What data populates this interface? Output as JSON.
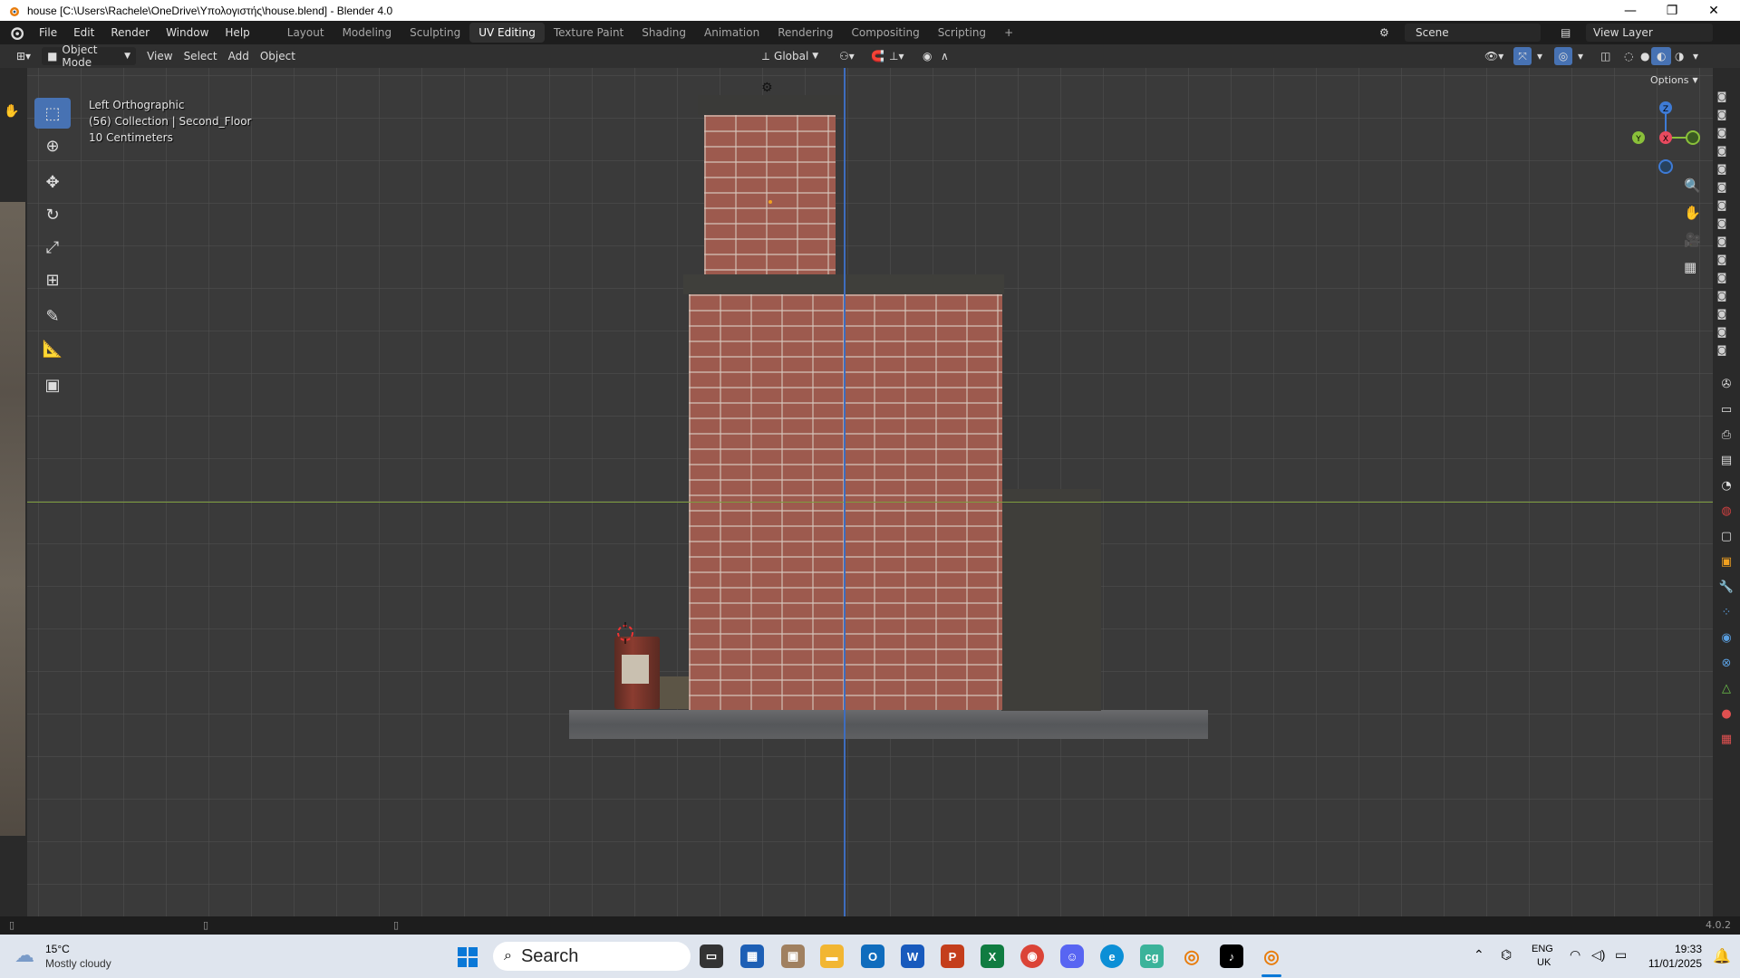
{
  "window": {
    "title": "house [C:\\Users\\Rachele\\OneDrive\\Υπολογιστής\\house.blend] - Blender 4.0",
    "minimize": "—",
    "maximize": "❐",
    "close": "✕"
  },
  "menu": [
    "File",
    "Edit",
    "Render",
    "Window",
    "Help"
  ],
  "workspaces": [
    "Layout",
    "Modeling",
    "Sculpting",
    "UV Editing",
    "Texture Paint",
    "Shading",
    "Animation",
    "Rendering",
    "Compositing",
    "Scripting"
  ],
  "active_workspace": "UV Editing",
  "add_workspace": "+",
  "scene": {
    "label": "Scene",
    "view_layer": "View Layer"
  },
  "header": {
    "mode": "Object Mode",
    "view": "View",
    "select": "Select",
    "add": "Add",
    "object": "Object",
    "orientation": "Global",
    "options": "Options"
  },
  "viewport": {
    "view_name": "Left Orthographic",
    "collection": "(56) Collection | Second_Floor",
    "scale": "10 Centimeters"
  },
  "gizmo": {
    "z": "Z",
    "y": "Y",
    "x": "X"
  },
  "statusbar": {
    "version": "4.0.2"
  },
  "taskbar": {
    "weather_temp": "15°C",
    "weather_desc": "Mostly cloudy",
    "search": "Search",
    "lang": "ENG",
    "region": "UK",
    "time": "19:33",
    "date": "11/01/2025"
  },
  "colors": {
    "accent": "#4772b3",
    "x_axis": "#e84a5f",
    "y_axis": "#8ac03a",
    "z_axis": "#3e7bd6",
    "brick": "#9d5a4e"
  }
}
